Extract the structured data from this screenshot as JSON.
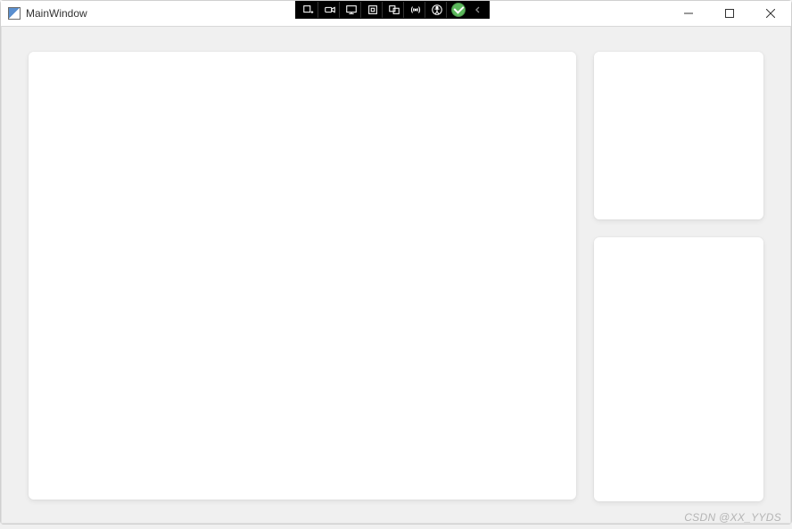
{
  "window": {
    "title": "MainWindow"
  },
  "overlay_toolbar": {
    "items": [
      {
        "name": "add-icon"
      },
      {
        "name": "camera-icon"
      },
      {
        "name": "present-icon"
      },
      {
        "name": "select-icon"
      },
      {
        "name": "group-icon"
      },
      {
        "name": "broadcast-icon"
      },
      {
        "name": "accessibility-icon"
      },
      {
        "name": "check-icon"
      }
    ]
  },
  "watermark": "CSDN @XX_YYDS"
}
